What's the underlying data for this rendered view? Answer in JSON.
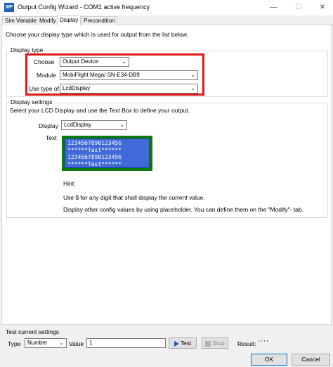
{
  "window": {
    "title": "Output Config Wizard - COM1 active frequency",
    "app_icon": "MF"
  },
  "tabs": [
    {
      "label": "Sim Variable"
    },
    {
      "label": "Modify"
    },
    {
      "label": "Display"
    },
    {
      "label": "Precondition"
    }
  ],
  "intro": "Choose your display type which is used for output from the list below.",
  "display_type": {
    "title": "Display type",
    "choose_label": "Choose",
    "choose_value": "Output Device",
    "module_label": "Module",
    "module_value": "MobiFlight Mega/ SN-E34-DB9",
    "type_label": "Use type of",
    "type_value": "LcdDisplay"
  },
  "display_settings": {
    "title": "Display settings",
    "intro": "Select your LCD Display and use the Text Box to define your output.",
    "display_label": "Display",
    "display_value": "LcdDisplay",
    "text_label": "Text",
    "lcd_text": "1234567890123456\n******Test******\n1234567890123456\n******Test******",
    "hint_title": "Hint:",
    "hint_1": "Use $ for any digit that shall display the current value.",
    "hint_2": "Display other config values by using placeholder. You can define them on the \"Modify\"- tab."
  },
  "test": {
    "title": "Test current settings",
    "type_label": "Type",
    "type_value": "Number",
    "value_label": "Value",
    "value": "1",
    "test_button": "Test",
    "stop_button": "Stop",
    "result_label": "Result:",
    "result_value": "' ' ' '"
  },
  "footer": {
    "ok": "OK",
    "cancel": "Cancel"
  },
  "colors": {
    "highlight_red": "#e0161a",
    "lcd_blue": "#3f6ad8",
    "lcd_frame_green": "#0d7a0d"
  }
}
